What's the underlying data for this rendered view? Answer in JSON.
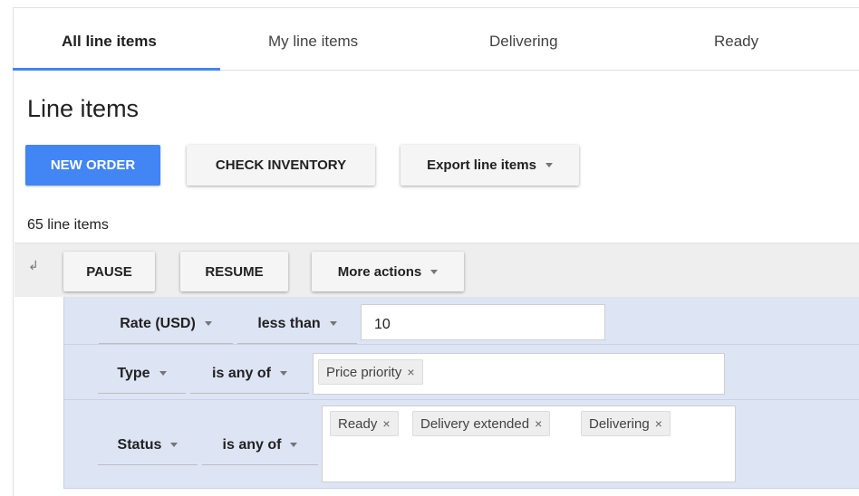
{
  "tabs": [
    {
      "label": "All line items",
      "active": true
    },
    {
      "label": "My line items",
      "active": false
    },
    {
      "label": "Delivering",
      "active": false
    },
    {
      "label": "Ready",
      "active": false
    }
  ],
  "page_title": "Line items",
  "actions": {
    "new_order": "NEW ORDER",
    "check_inventory": "CHECK INVENTORY",
    "export": "Export line items"
  },
  "count_text": "65 line items",
  "toolbar": {
    "pause": "PAUSE",
    "resume": "RESUME",
    "more": "More actions"
  },
  "filters": [
    {
      "field": "Rate (USD)",
      "operator": "less than",
      "value": "10"
    },
    {
      "field": "Type",
      "operator": "is any of",
      "chips": [
        "Price priority"
      ]
    },
    {
      "field": "Status",
      "operator": "is any of",
      "chips": [
        "Ready",
        "Delivery extended",
        "Delivering"
      ]
    }
  ],
  "icons": {
    "chip_remove": "×",
    "collapse": "↲"
  },
  "colors": {
    "accent": "#4285f4",
    "filter_bg": "#dde4f4",
    "toolbar_bg": "#eeeeee"
  }
}
